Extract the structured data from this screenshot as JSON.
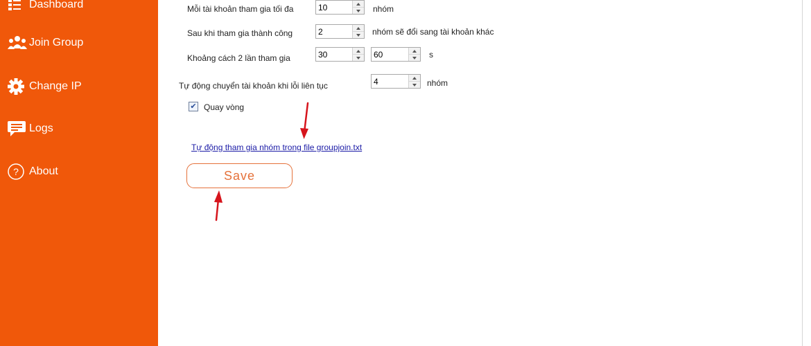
{
  "sidebar": {
    "items": [
      {
        "label": "Dashboard",
        "icon": "dashboard-icon"
      },
      {
        "label": "Join Group",
        "icon": "group-icon"
      },
      {
        "label": "Change IP",
        "icon": "gear-icon"
      },
      {
        "label": "Logs",
        "icon": "chat-icon"
      },
      {
        "label": "About",
        "icon": "help-icon"
      }
    ]
  },
  "settings": {
    "max_groups": {
      "label": "Mỗi tài khoản tham gia tối đa",
      "value": "10",
      "unit": "nhóm"
    },
    "switch_after": {
      "label": "Sau khi tham gia thành công",
      "value": "2",
      "suffix": "nhóm sẽ đổi sang tài khoản khác"
    },
    "interval": {
      "label": "Khoảng cách 2 lần tham gia",
      "min": "30",
      "max": "60",
      "unit": "s"
    },
    "auto_switch": {
      "label": "Tự động chuyển tài khoản khi lỗi liên tục",
      "value": "4",
      "unit": "nhóm"
    },
    "loop": {
      "label": "Quay vòng",
      "checked": true
    },
    "link_text": "Tự động tham gia nhóm trong file groupjoin.txt",
    "save_label": "Save"
  },
  "colors": {
    "sidebar": "#f0580a",
    "accent": "#e5713a",
    "arrow": "#d6141c"
  }
}
